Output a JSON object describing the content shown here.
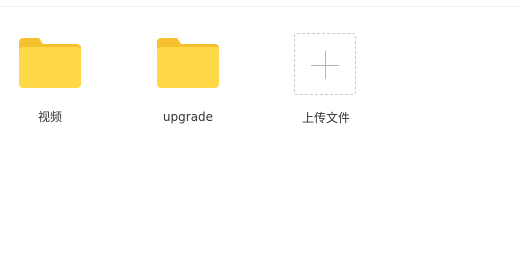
{
  "folders": [
    {
      "name": "视频",
      "icon": "folder-icon"
    },
    {
      "name": "upgrade",
      "icon": "folder-icon"
    }
  ],
  "upload": {
    "label": "上传文件",
    "icon": "plus-icon"
  },
  "colors": {
    "folder_back": "#F6C12F",
    "folder_front": "#FFD84A",
    "upload_border": "#C8C8C8",
    "plus": "#B6B6B6",
    "label_text": "#333333"
  }
}
